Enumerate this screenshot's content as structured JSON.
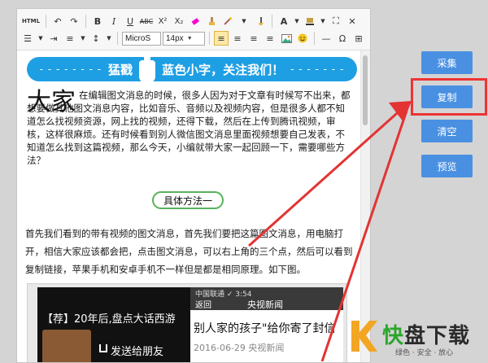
{
  "toolbar": {
    "font_family": "MicroS",
    "font_size": "14px",
    "html_label": "HTML"
  },
  "banner": {
    "left_dots": "- - - - - - - -",
    "text_left": "猛戳",
    "text_right": "蓝色小字，关注我们！",
    "right_dots": "- - - - - - -"
  },
  "intro": {
    "big_chars": "大家",
    "text": "在编辑图文消息的时候，很多人因为对于文章有时候写不出来，都想要做其他图文消息内容，比如音乐、音频以及视频内容，但是很多人都不知道怎么找视频资源，网上找的视频，还得下载，然后在上传到腾讯视频，审核，这样很麻烦。还有时候看到别人微信图文消息里面视频想要自己发表，不知道怎么找到这篇视频，那么今天，小编就带大家一起回顾一下，需要哪些方法？"
  },
  "method_label": "具体方法一",
  "paragraph": "首先我们看到的带有视频的图文消息，首先我们要把这篇图文消息，用电脑打开，相信大家应该都会把，点击图文消息，可以右上角的三个点，然后可以看到 复制链接，苹果手机和安卓手机不一样但是都是相同原理。如下图。",
  "screens": {
    "left_title": "【荐】20年后,盘点大话西游",
    "left_share": "发送给朋友",
    "right_status": "中国联通 ✓  3:54",
    "right_back": "返回",
    "right_name": "央视新闻",
    "right_headline": "别人家的孩子\"给你寄了封信",
    "right_date": "2016-06-29  央视新闻"
  },
  "side_buttons": {
    "collect": "采集",
    "copy": "复制",
    "clear": "清空",
    "preview": "预览"
  },
  "watermark": {
    "fast": "快",
    "rest": "盘下载",
    "sub": "绿色 · 安全 · 放心"
  },
  "colors": {
    "banner": "#1e9fe3",
    "side_button": "#4a90e2",
    "highlight": "#e33333",
    "method_border": "#58b25c"
  }
}
